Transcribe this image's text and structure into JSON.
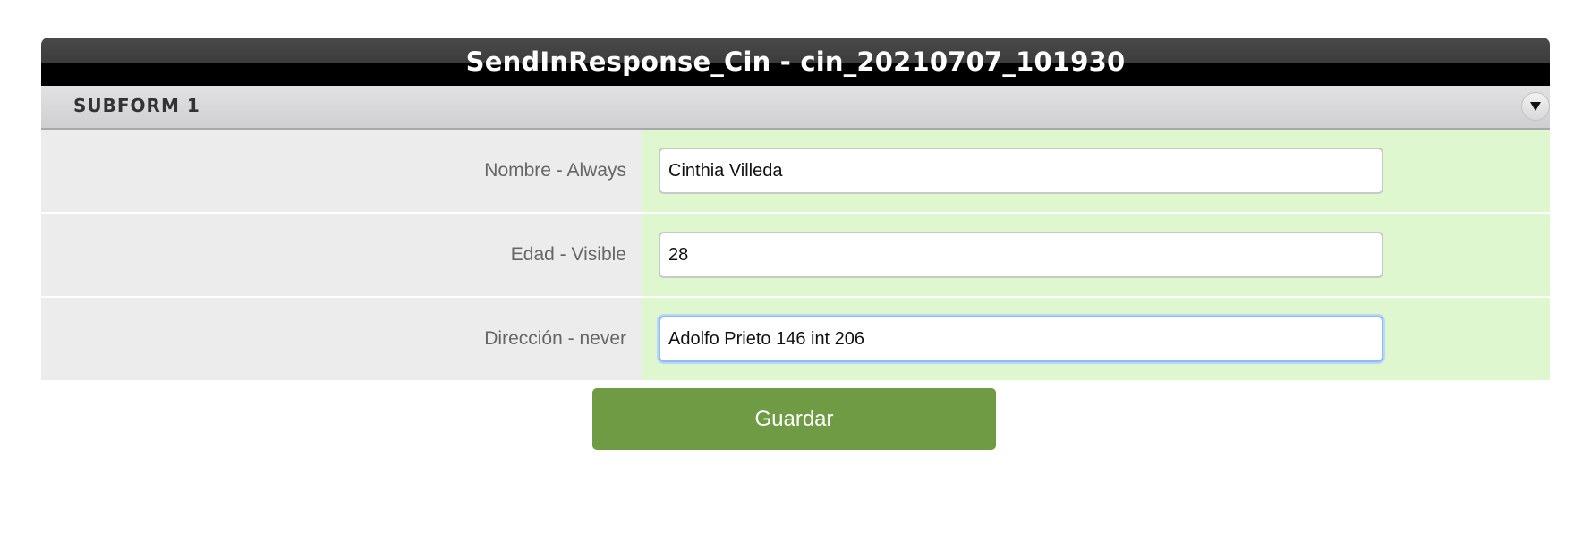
{
  "form": {
    "title": "SendInResponse_Cin - cin_20210707_101930",
    "subform": {
      "title": "SUBFORM 1",
      "toggle_icon": "chevron-down-icon"
    },
    "fields": [
      {
        "label": "Nombre - Always",
        "value": "Cinthia Villeda",
        "focused": false
      },
      {
        "label": "Edad - Visible",
        "value": "28",
        "focused": false
      },
      {
        "label": "Dirección - never",
        "value": "Adolfo Prieto 146 int 206",
        "focused": true
      }
    ],
    "save_label": "Guardar"
  },
  "colors": {
    "title_bar": "#000000",
    "label_bg": "#ececec",
    "field_bg": "#dff7ce",
    "button": "#6f9b45",
    "focus_ring": "#8fbcf2"
  }
}
